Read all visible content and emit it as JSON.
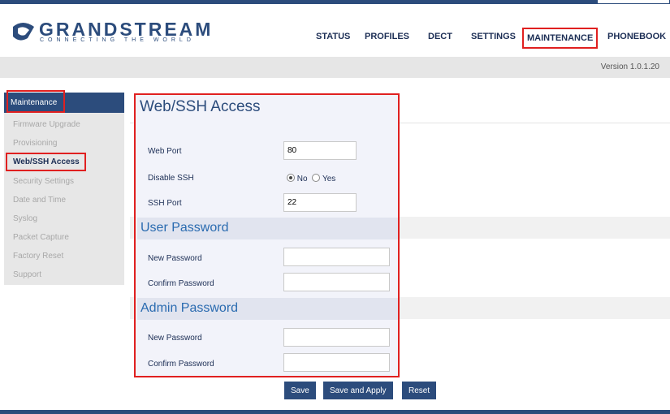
{
  "brand": {
    "name": "GRANDSTREAM",
    "tagline": "CONNECTING THE WORLD"
  },
  "nav": {
    "items": [
      "STATUS",
      "PROFILES",
      "DECT",
      "SETTINGS",
      "MAINTENANCE",
      "PHONEBOOK"
    ],
    "active": "MAINTENANCE"
  },
  "version": "Version 1.0.1.20",
  "sidebar": {
    "header": "Maintenance",
    "items": [
      "Firmware Upgrade",
      "Provisioning",
      "Web/SSH Access",
      "Security Settings",
      "Date and Time",
      "Syslog",
      "Packet Capture",
      "Factory Reset",
      "Support"
    ],
    "active": "Web/SSH Access"
  },
  "page": {
    "title": "Web/SSH Access",
    "web_port": {
      "label": "Web Port",
      "value": "80"
    },
    "disable_ssh": {
      "label": "Disable SSH",
      "options": [
        "No",
        "Yes"
      ],
      "selected": "No"
    },
    "ssh_port": {
      "label": "SSH Port",
      "value": "22"
    },
    "user_password": {
      "title": "User Password",
      "new_label": "New Password",
      "confirm_label": "Confirm Password"
    },
    "admin_password": {
      "title": "Admin Password",
      "new_label": "New Password",
      "confirm_label": "Confirm Password"
    }
  },
  "buttons": {
    "save": "Save",
    "save_apply": "Save and Apply",
    "reset": "Reset"
  },
  "colors": {
    "primary": "#2c4c7c",
    "highlight": "#e02020",
    "section_title": "#2a6bb0"
  }
}
